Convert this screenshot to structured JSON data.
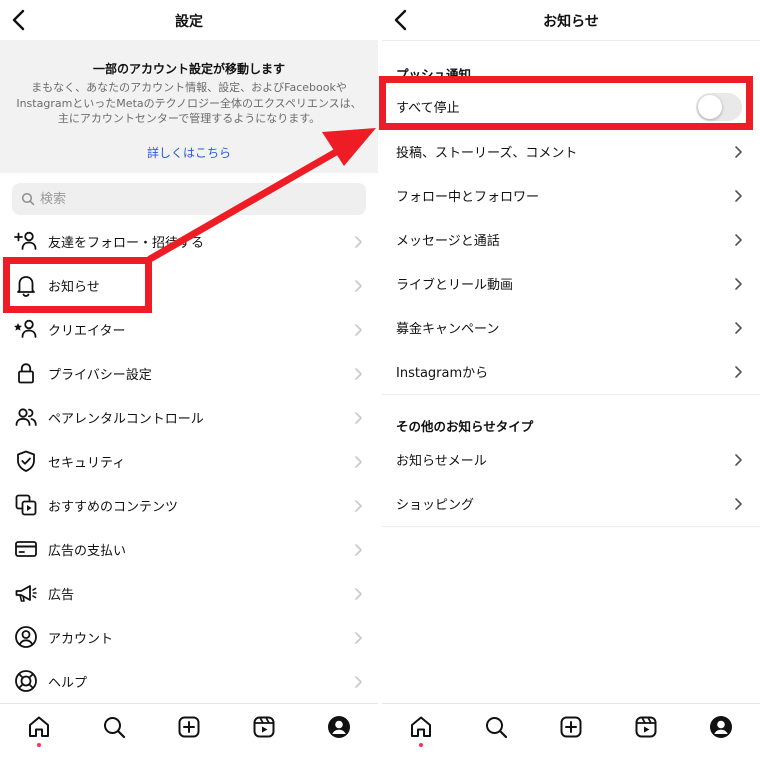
{
  "left": {
    "title": "設定",
    "notice": {
      "title": "一部のアカウント設定が移動します",
      "body": "まもなく、あなたのアカウント情報、設定、およびFacebookやInstagramといったMetaのテクノロジー全体のエクスペリエンスは、主にアカウントセンターで管理するようになります。",
      "link": "詳しくはこちら"
    },
    "search": {
      "placeholder": "検索"
    },
    "menu": [
      {
        "label": "友達をフォロー・招待する",
        "icon": "add-person-icon"
      },
      {
        "label": "お知らせ",
        "icon": "bell-icon"
      },
      {
        "label": "クリエイター",
        "icon": "creator-star-icon"
      },
      {
        "label": "プライバシー設定",
        "icon": "lock-icon"
      },
      {
        "label": "ペアレンタルコントロール",
        "icon": "people-icon"
      },
      {
        "label": "セキュリティ",
        "icon": "shield-icon"
      },
      {
        "label": "おすすめのコンテンツ",
        "icon": "suggested-content-icon"
      },
      {
        "label": "広告の支払い",
        "icon": "card-icon"
      },
      {
        "label": "広告",
        "icon": "megaphone-icon"
      },
      {
        "label": "アカウント",
        "icon": "account-icon"
      },
      {
        "label": "ヘルプ",
        "icon": "lifebuoy-icon"
      }
    ]
  },
  "right": {
    "title": "お知らせ",
    "push_section": "プッシュ通知",
    "pause_all": {
      "label": "すべて停止",
      "on": false
    },
    "push_items": [
      "投稿、ストーリーズ、コメント",
      "フォロー中とフォロワー",
      "メッセージと通話",
      "ライブとリール動画",
      "募金キャンペーン",
      "Instagramから"
    ],
    "other_section": "その他のお知らせタイプ",
    "other_items": [
      "お知らせメール",
      "ショッピング"
    ]
  },
  "tabbar": {
    "tabs": [
      "home-icon",
      "search-icon",
      "create-icon",
      "reels-icon",
      "profile-icon"
    ]
  },
  "colors": {
    "highlight": "#ee1c25",
    "link": "#2a5bd7",
    "notification_dot": "#ff2d55"
  }
}
